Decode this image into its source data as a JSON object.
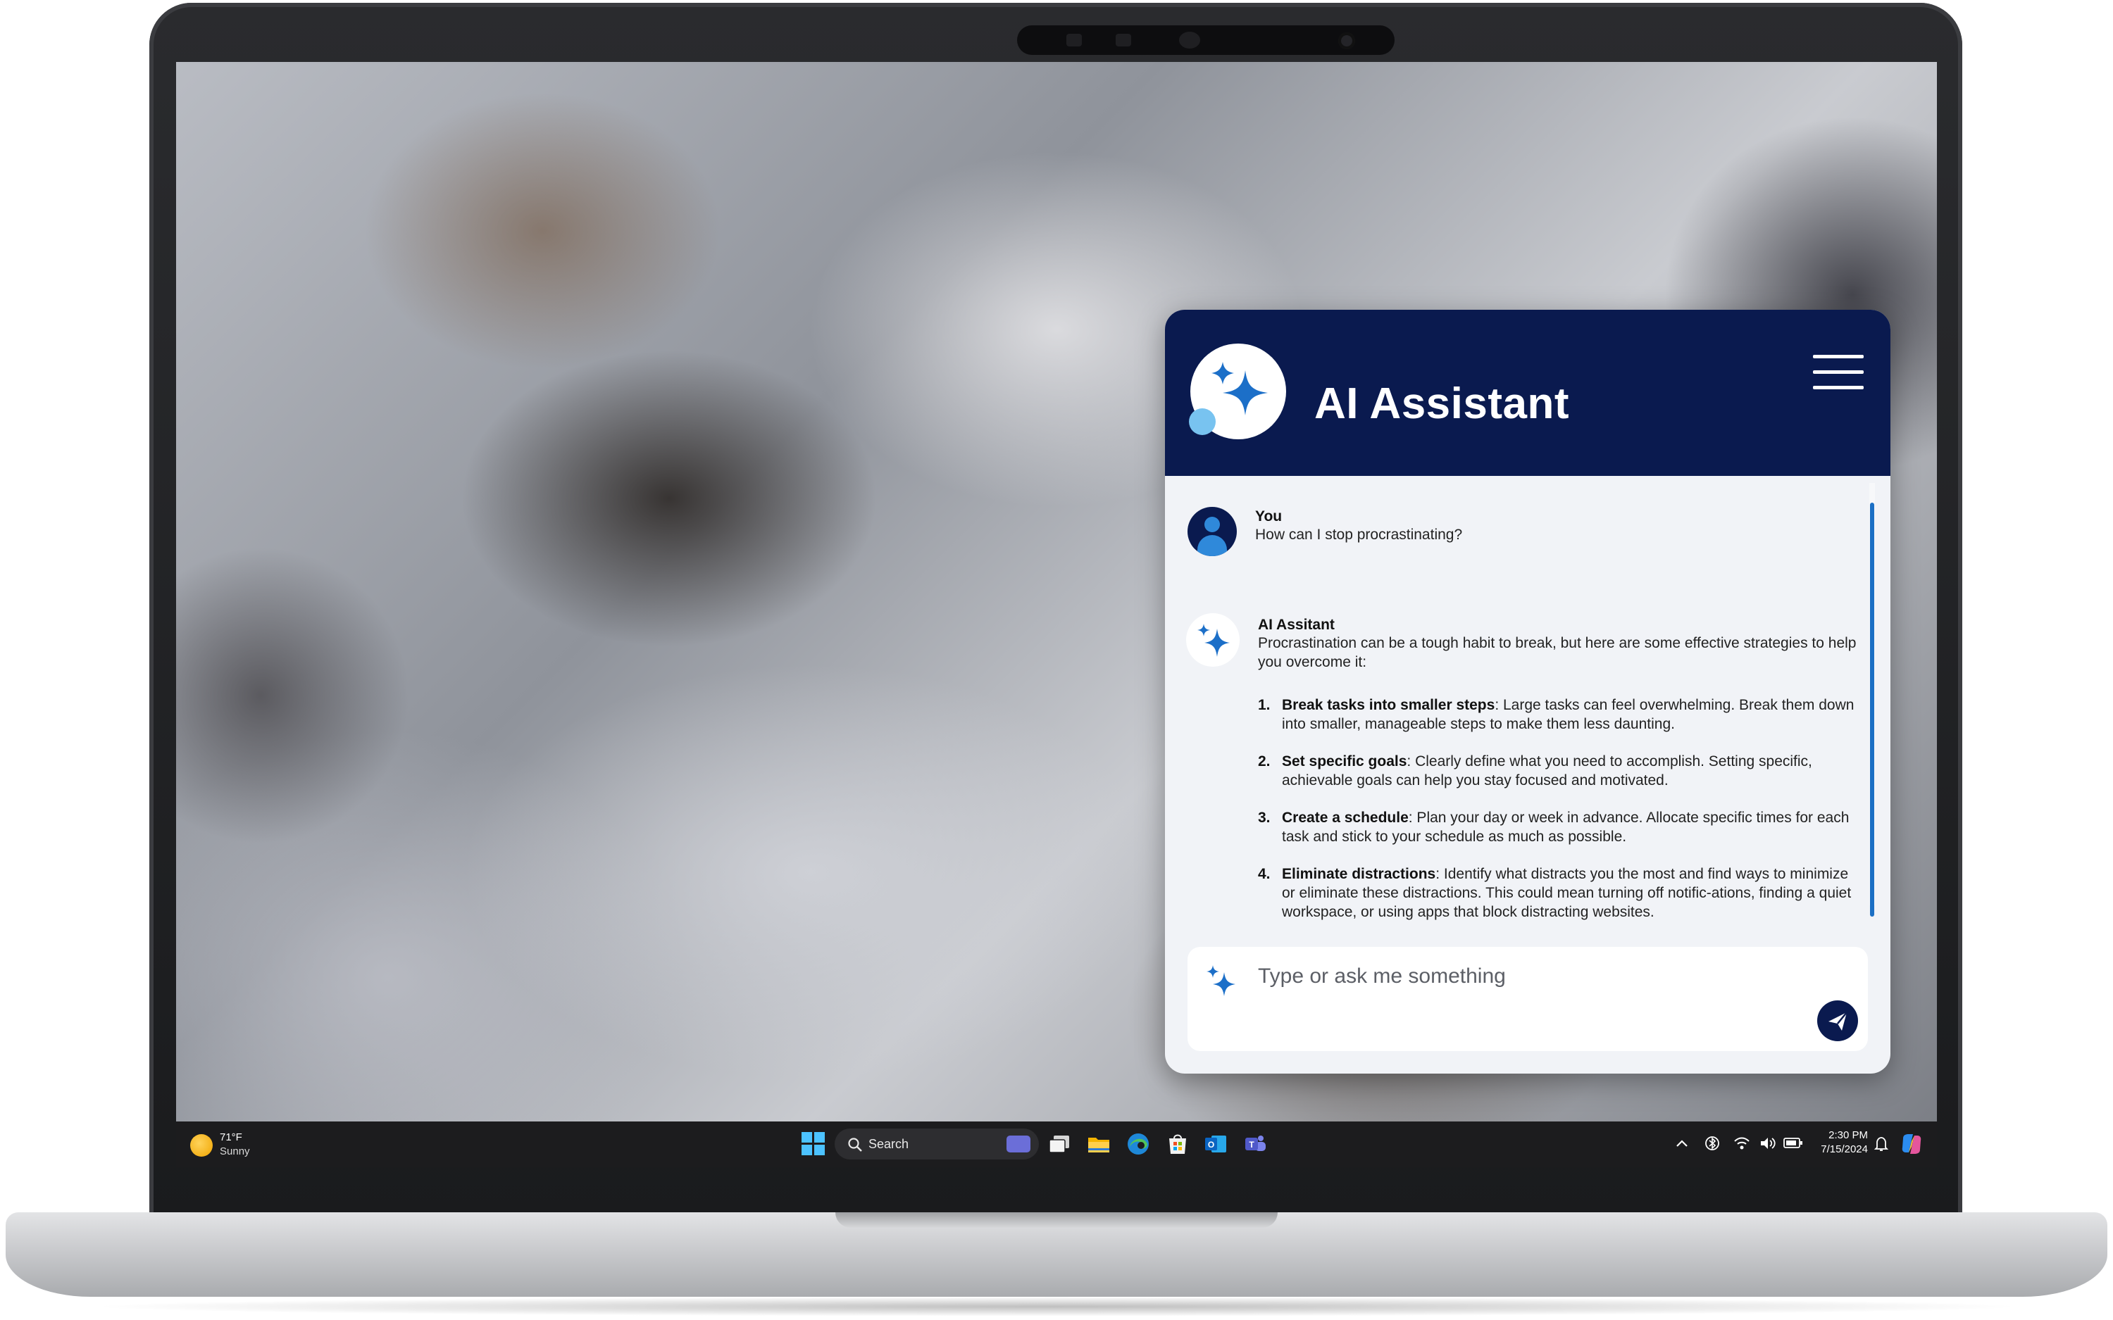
{
  "assistant": {
    "title": "AI Assistant",
    "accent_color": "#0a1a4f",
    "link_color": "#1b6fc4",
    "menu_icon": "hamburger-menu-icon",
    "logo_icon": "sparkle-icon",
    "conversation": {
      "user_message": {
        "author": "You",
        "text": "How can I stop procrastinating?"
      },
      "ai_message": {
        "author": "AI Assitant",
        "intro": "Procrastination can be a tough habit to break, but here are some effective strategies to help you overcome it:",
        "strategies": [
          {
            "number": "1.",
            "title": "Break tasks into smaller steps",
            "text": ": Large tasks can feel overwhelming. Break them down into smaller, manageable steps to make them less daunting."
          },
          {
            "number": "2.",
            "title": "Set specific goals",
            "text": ": Clearly define what you need to accomplish. Setting specific, achievable goals can help you stay focused and motivated."
          },
          {
            "number": "3.",
            "title": "Create a schedule",
            "text": ": Plan your day or week in advance. Allocate specific times for each task and stick to your schedule as much as possible."
          },
          {
            "number": "4.",
            "title": "Eliminate distractions",
            "text": ": Identify what distracts you the most and find ways to minimize or eliminate these distractions. This could mean turning off notific-ations, finding a quiet workspace, or using apps that block distracting websites."
          }
        ]
      }
    },
    "composer": {
      "placeholder": "Type or ask me something",
      "send_icon": "send-icon"
    }
  },
  "taskbar": {
    "weather": {
      "temperature": "71°F",
      "condition": "Sunny",
      "icon": "sun-icon"
    },
    "search": {
      "label": "Search"
    },
    "pinned_apps": [
      "windows-start-icon",
      "task-view-icon",
      "file-explorer-icon",
      "edge-browser-icon",
      "microsoft-store-icon",
      "outlook-icon",
      "teams-icon"
    ],
    "tray": {
      "time": "2:30 PM",
      "date": "7/15/2024",
      "icons": [
        "chevron-up-icon",
        "bluetooth-icon",
        "wifi-icon",
        "volume-icon",
        "battery-icon",
        "notification-bell-icon",
        "copilot-icon"
      ]
    }
  }
}
